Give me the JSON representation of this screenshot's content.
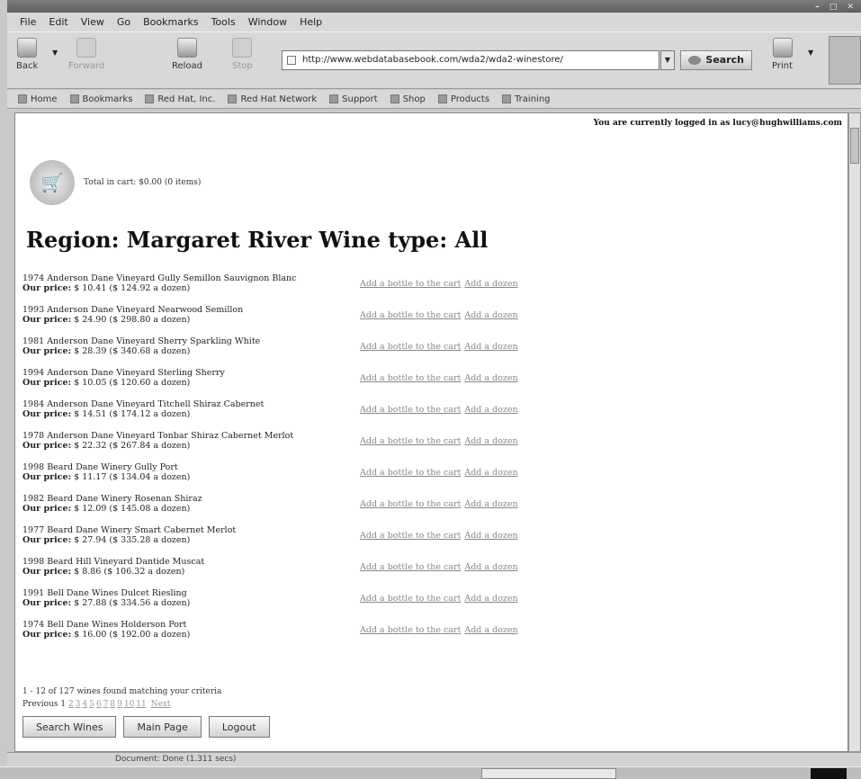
{
  "menu": [
    "File",
    "Edit",
    "View",
    "Go",
    "Bookmarks",
    "Tools",
    "Window",
    "Help"
  ],
  "nav": {
    "back": "Back",
    "forward": "Forward",
    "reload": "Reload",
    "stop": "Stop",
    "url": "http://www.webdatabasebook.com/wda2/wda2-winestore/",
    "search": "Search",
    "print": "Print"
  },
  "bookmarks": [
    "Home",
    "Bookmarks",
    "Red Hat, Inc.",
    "Red Hat Network",
    "Support",
    "Shop",
    "Products",
    "Training"
  ],
  "login_text": "You are currently logged in as lucy@hughwilliams.com",
  "cart_text": "Total in cart: $0.00 (0 items)",
  "heading": "Region: Margaret River Wine type: All",
  "add_bottle": "Add a bottle to the cart",
  "add_dozen": "Add a dozen",
  "wines": [
    {
      "name": "1974 Anderson Dane Vineyard Gully Semillon Sauvignon Blanc",
      "price_label": "Our price:",
      "price": "$ 10.41 ($ 124.92 a dozen)"
    },
    {
      "name": "1993 Anderson Dane Vineyard Nearwood Semillon",
      "price_label": "Our price:",
      "price": "$ 24.90 ($ 298.80 a dozen)"
    },
    {
      "name": "1981 Anderson Dane Vineyard Sherry Sparkling White",
      "price_label": "Our price:",
      "price": "$ 28.39 ($ 340.68 a dozen)"
    },
    {
      "name": "1994 Anderson Dane Vineyard Sterling Sherry",
      "price_label": "Our price:",
      "price": "$ 10.05 ($ 120.60 a dozen)"
    },
    {
      "name": "1984 Anderson Dane Vineyard Titchell Shiraz Cabernet",
      "price_label": "Our price:",
      "price": "$ 14.51 ($ 174.12 a dozen)"
    },
    {
      "name": "1978 Anderson Dane Vineyard Tonbar Shiraz Cabernet Merlot",
      "price_label": "Our price:",
      "price": "$ 22.32 ($ 267.84 a dozen)"
    },
    {
      "name": "1998 Beard Dane Winery Gully Port",
      "price_label": "Our price:",
      "price": "$ 11.17 ($ 134.04 a dozen)"
    },
    {
      "name": "1982 Beard Dane Winery Rosenan Shiraz",
      "price_label": "Our price:",
      "price": "$ 12.09 ($ 145.08 a dozen)"
    },
    {
      "name": "1977 Beard Dane Winery Smart Cabernet Merlot",
      "price_label": "Our price:",
      "price": "$ 27.94 ($ 335.28 a dozen)"
    },
    {
      "name": "1998 Beard Hill Vineyard Dantide Muscat",
      "price_label": "Our price:",
      "price": "$ 8.86 ($ 106.32 a dozen)"
    },
    {
      "name": "1991 Bell Dane Wines Dulcet Riesling",
      "price_label": "Our price:",
      "price": "$ 27.88 ($ 334.56 a dozen)"
    },
    {
      "name": "1974 Bell Dane Wines Holderson Port",
      "price_label": "Our price:",
      "price": "$ 16.00 ($ 192.00 a dozen)"
    }
  ],
  "summary": "1 - 12 of 127 wines found matching your criteria",
  "pager": {
    "prev_label": "Previous",
    "current": "1",
    "pages": [
      "2",
      "3",
      "4",
      "5",
      "6",
      "7",
      "8",
      "9",
      "10",
      "11"
    ],
    "next_label": "Next"
  },
  "buttons": {
    "search": "Search Wines",
    "main": "Main Page",
    "logout": "Logout"
  },
  "status": "Document: Done (1.311 secs)"
}
